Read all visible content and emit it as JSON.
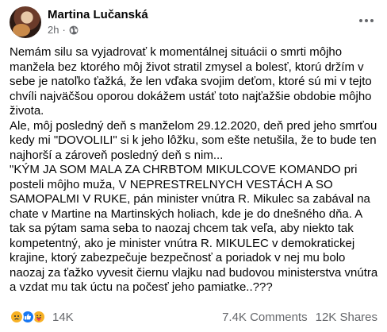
{
  "post": {
    "author": "Martina Lučanská",
    "time": "2h",
    "separator": "·",
    "privacy_icon": "globe-icon",
    "more_icon": "more-horizontal-icon",
    "lines": [
      "Nemám silu sa vyjadrovať k momentálnej situácii o smrti môjho",
      "manžela bez ktorého môj život stratil zmysel a bolesť, ktorú držím v",
      "sebe je natoľko ťažká, že len vďaka svojim deťom, ktoré sú mi v tejto",
      "chvíli najväčšou oporou dokážem ustáť toto najťažšie obdobie môjho",
      "života.",
      "Ale, môj posledný deň s manželom 29.12.2020, deň pred jeho smrťou",
      "kedy mi \"DOVOLILI\" si k jeho lôžku, som ešte netušila, že to bude ten",
      "najhorší a zároveň posledný deň s nim...",
      "\"KÝM JA SOM MALA ZA CHRBTOM MIKULCOVE KOMANDO  pri",
      "posteli môjho muža, V NEPRESTRELNYCH VESTÁCH A SO",
      "SAMOPALMI V RUKE, pán minister vnútra R. Mikulec sa zabával na",
      "chate v Martine na Martinských holiach, kde je do dnešného dňa. A",
      "tak sa pýtam sama seba to naozaj chcem tak veľa, aby niekto tak",
      "kompetentný, ako je minister vnútra R. MIKULEC v demokratickej",
      "krajine, ktorý zabezpečuje bezpečnosť a poriadok v nej mu bolo",
      "naozaj za ťažko vyvesit čiernu vlajku nad budovou ministerstva vnútra",
      "a vzdat mu tak úctu na počesť jeho pamiatke..???"
    ]
  },
  "footer": {
    "reaction_icons": [
      "sad-reaction-icon",
      "like-reaction-icon",
      "care-reaction-icon"
    ],
    "reaction_count": "14K",
    "comments": "7.4K Comments",
    "shares": "12K Shares"
  }
}
